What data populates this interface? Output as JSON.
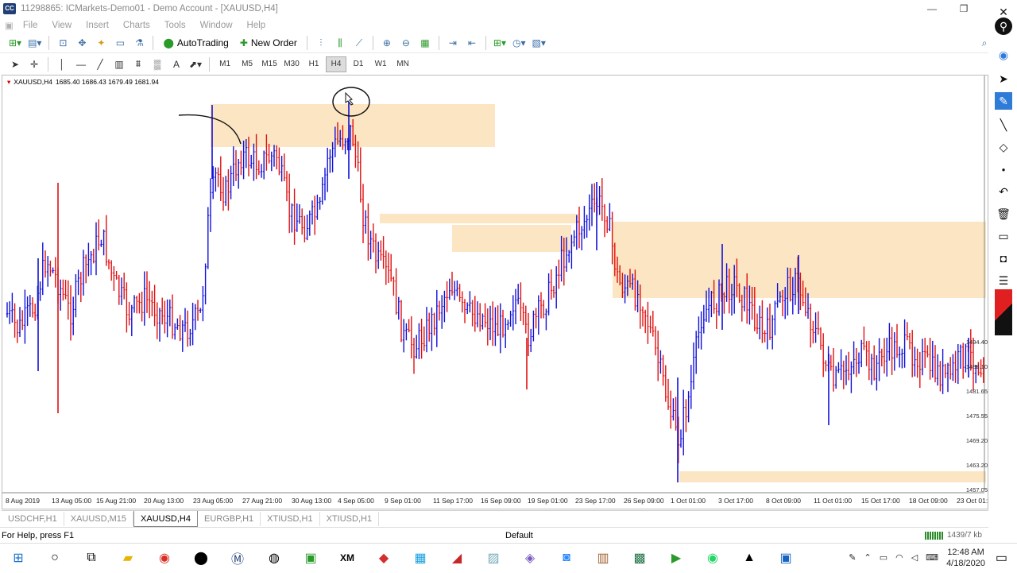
{
  "window": {
    "title": "11298865: ICMarkets-Demo01 - Demo Account - [XAUUSD,H4]",
    "app_icon_label": "CC",
    "minimize": "—",
    "maximize": "❐",
    "close": "✕"
  },
  "menu": [
    "File",
    "View",
    "Insert",
    "Charts",
    "Tools",
    "Window",
    "Help"
  ],
  "toolbar": {
    "autotrading_label": "AutoTrading",
    "new_order_label": "New Order"
  },
  "timeframes": [
    "M1",
    "M5",
    "M15",
    "M30",
    "H1",
    "H4",
    "D1",
    "W1",
    "MN"
  ],
  "active_timeframe": "H4",
  "chart": {
    "header_symbol": "XAUUSD,H4",
    "header_ohlc": "1685.40 1686.43 1679.49 1681.94",
    "colors": {
      "bull": "#1010d8",
      "bear": "#e01010",
      "zone": "#fbe2bb",
      "background": "#ffffff"
    }
  },
  "chart_data": {
    "type": "candlestick",
    "symbol": "XAUUSD",
    "timeframe": "H4",
    "x_labels": [
      "8 Aug 2019",
      "13 Aug 05:00",
      "15 Aug 21:00",
      "20 Aug 13:00",
      "23 Aug 05:00",
      "27 Aug 21:00",
      "30 Aug 13:00",
      "4 Sep 05:00",
      "9 Sep 01:00",
      "11 Sep 17:00",
      "16 Sep 09:00",
      "19 Sep 01:00",
      "23 Sep 17:00",
      "26 Sep 09:00",
      "1 Oct 01:00",
      "3 Oct 17:00",
      "8 Oct 09:00",
      "11 Oct 01:00",
      "15 Oct 17:00",
      "18 Oct 09:00",
      "23 Oct 01:00"
    ],
    "y_labels": [
      "1494.40",
      "1488.10",
      "1481.65",
      "1475.55",
      "1469.20",
      "1463.20",
      "1457.05"
    ],
    "supply_demand_zones": 5,
    "annotations": [
      "hand-drawn circle at top wick",
      "hand-drawn curve line"
    ]
  },
  "tabs": [
    "USDCHF,H1",
    "XAUUSD,M15",
    "XAUUSD,H4",
    "EURGBP,H1",
    "XTIUSD,H1",
    "XTIUSD,H1"
  ],
  "active_tab": "XAUUSD,H4",
  "status": {
    "help": "For Help, press F1",
    "profile": "Default",
    "connection": "1439/7 kb"
  },
  "clock": {
    "time": "12:48 AM",
    "date": "4/18/2020"
  }
}
